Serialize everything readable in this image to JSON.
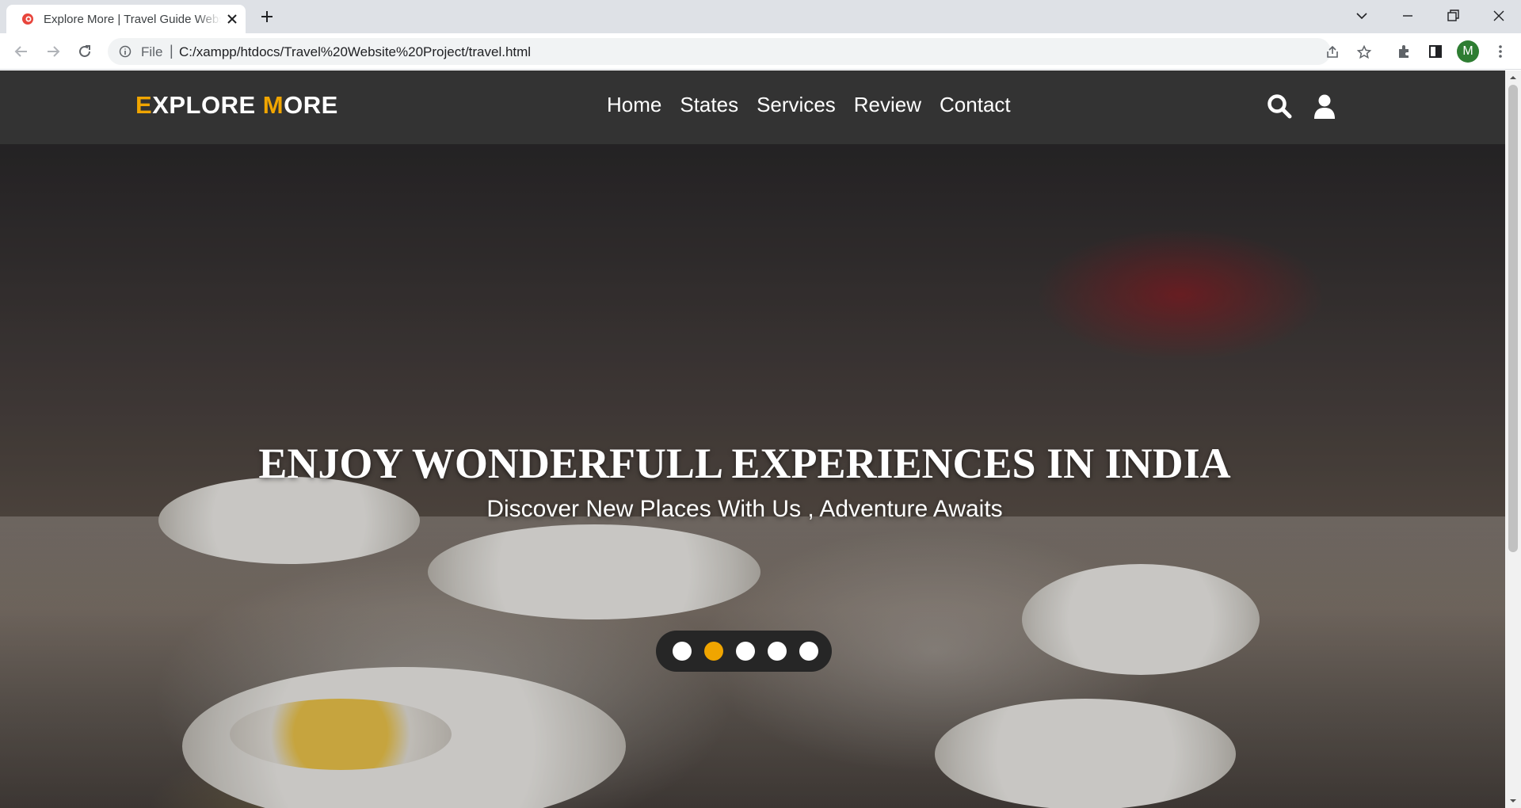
{
  "browser": {
    "tab_title": "Explore More | Travel Guide Website",
    "url_scheme": "File",
    "url_separator": "|",
    "url": "C:/xampp/htdocs/Travel%20Website%20Project/travel.html",
    "profile_initial": "M"
  },
  "navbar": {
    "logo_e": "E",
    "logo_xplore": "XPLORE ",
    "logo_m": "M",
    "logo_ore": "ORE",
    "links": [
      "Home",
      "States",
      "Services",
      "Review",
      "Contact"
    ],
    "icons": [
      "search-icon",
      "user-icon"
    ]
  },
  "hero": {
    "title": "ENJOY WONDERFULL EXPERIENCES IN INDIA",
    "subtitle": "Discover New Places With Us , Adventure Awaits",
    "slides_total": 5,
    "active_slide": 2
  },
  "colors": {
    "accent": "#f0a500",
    "navbar_bg": "#333333",
    "controls_bg": "#262626"
  }
}
